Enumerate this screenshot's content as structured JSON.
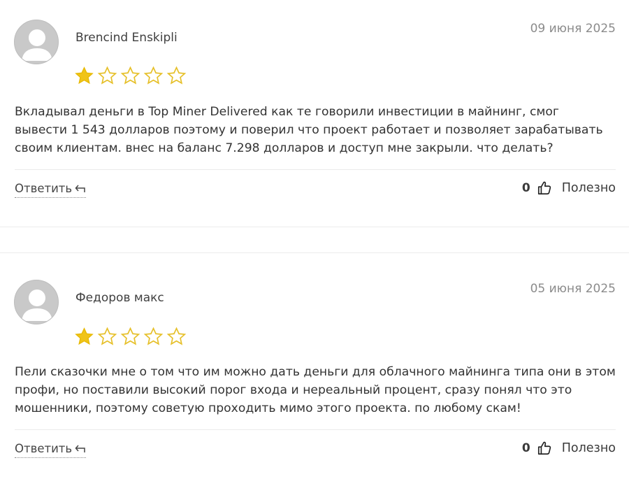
{
  "reviews": [
    {
      "author": "Brencind Enskipli",
      "date": "09 июня 2025",
      "rating": 1,
      "max_rating": 5,
      "lines": [
        "Вкладывал деньги в Top Miner Delivered как те говорили инвестиции в майнинг, смог",
        "вывести 1 543 долларов поэтому и поверил что проект работает и позволяет зарабатывать",
        "своим клиентам. внес на баланс 7.298 долларов и доступ мне закрыли. что делать?"
      ],
      "reply_label": "Ответить",
      "useful_count": "0",
      "useful_label": "Полезно"
    },
    {
      "author": "Федоров макс",
      "date": "05 июня 2025",
      "rating": 1,
      "max_rating": 5,
      "lines": [
        "Пели сказочки мне о том что им можно дать деньги для облачного майнинга типа они в этом",
        "профи, но поставили высокий порог входа и нереальный процент, сразу понял что это",
        "мошенники, поэтому советую проходить мимо этого проекта. по любому скам!"
      ],
      "reply_label": "Ответить",
      "useful_count": "0",
      "useful_label": "Полезно"
    }
  ],
  "colors": {
    "star_filled": "#f0c419",
    "star_outline": "#e6c02a",
    "avatar_bg": "#c9c9c9",
    "avatar_figure": "#ffffff"
  },
  "icons": {
    "avatar": "user-placeholder-icon",
    "star": "star-icon",
    "reply": "reply-arrow-icon",
    "like": "thumbs-up-icon"
  }
}
